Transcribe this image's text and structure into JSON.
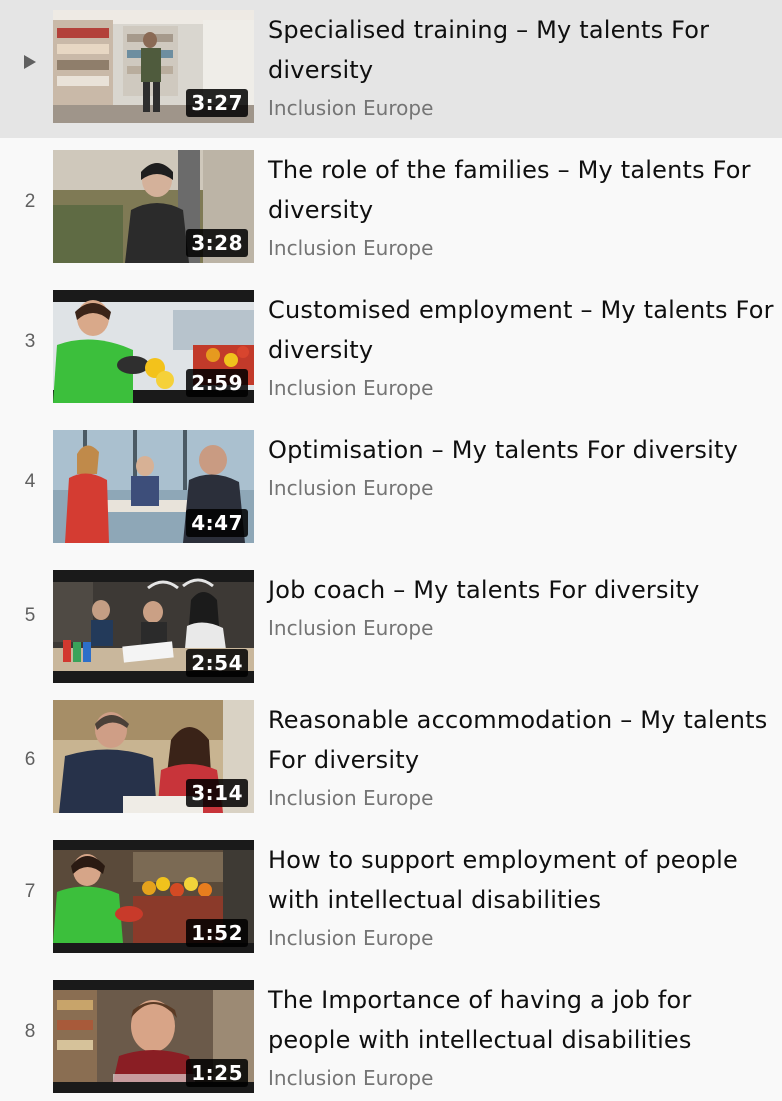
{
  "playlist": {
    "items": [
      {
        "index": "",
        "playing": true,
        "title": "Specialised training – My talents For diversity",
        "channel": "Inclusion Europe",
        "duration": "3:27",
        "thumbnail_icon": "store-aisle-thumbnail"
      },
      {
        "index": "2",
        "playing": false,
        "title": "The role of the families – My talents For diversity",
        "channel": "Inclusion Europe",
        "duration": "3:28",
        "thumbnail_icon": "person-portrait-thumbnail"
      },
      {
        "index": "3",
        "playing": false,
        "title": "Customised employment – My talents For diversity",
        "channel": "Inclusion Europe",
        "duration": "2:59",
        "thumbnail_icon": "produce-worker-thumbnail"
      },
      {
        "index": "4",
        "playing": false,
        "title": "Optimisation – My talents For diversity",
        "channel": "Inclusion Europe",
        "duration": "4:47",
        "thumbnail_icon": "meeting-thumbnail"
      },
      {
        "index": "5",
        "playing": false,
        "title": "Job coach – My talents For diversity",
        "channel": "Inclusion Europe",
        "duration": "2:54",
        "thumbnail_icon": "desk-work-thumbnail"
      },
      {
        "index": "6",
        "playing": false,
        "title": "Reasonable accommodation – My talents For diversity",
        "channel": "Inclusion Europe",
        "duration": "3:14",
        "thumbnail_icon": "office-pair-thumbnail"
      },
      {
        "index": "7",
        "playing": false,
        "title": "How to support employment of people with intellectual disabilities",
        "channel": "Inclusion Europe",
        "duration": "1:52",
        "thumbnail_icon": "market-worker-thumbnail"
      },
      {
        "index": "8",
        "playing": false,
        "title": "The Importance of having a job for people with intellectual disabilities",
        "channel": "Inclusion Europe",
        "duration": "1:25",
        "thumbnail_icon": "speaker-thumbnail"
      }
    ]
  },
  "colors": {
    "active_background": "#e5e5e5",
    "page_background": "#f9f9f9",
    "secondary_text": "#606060"
  }
}
